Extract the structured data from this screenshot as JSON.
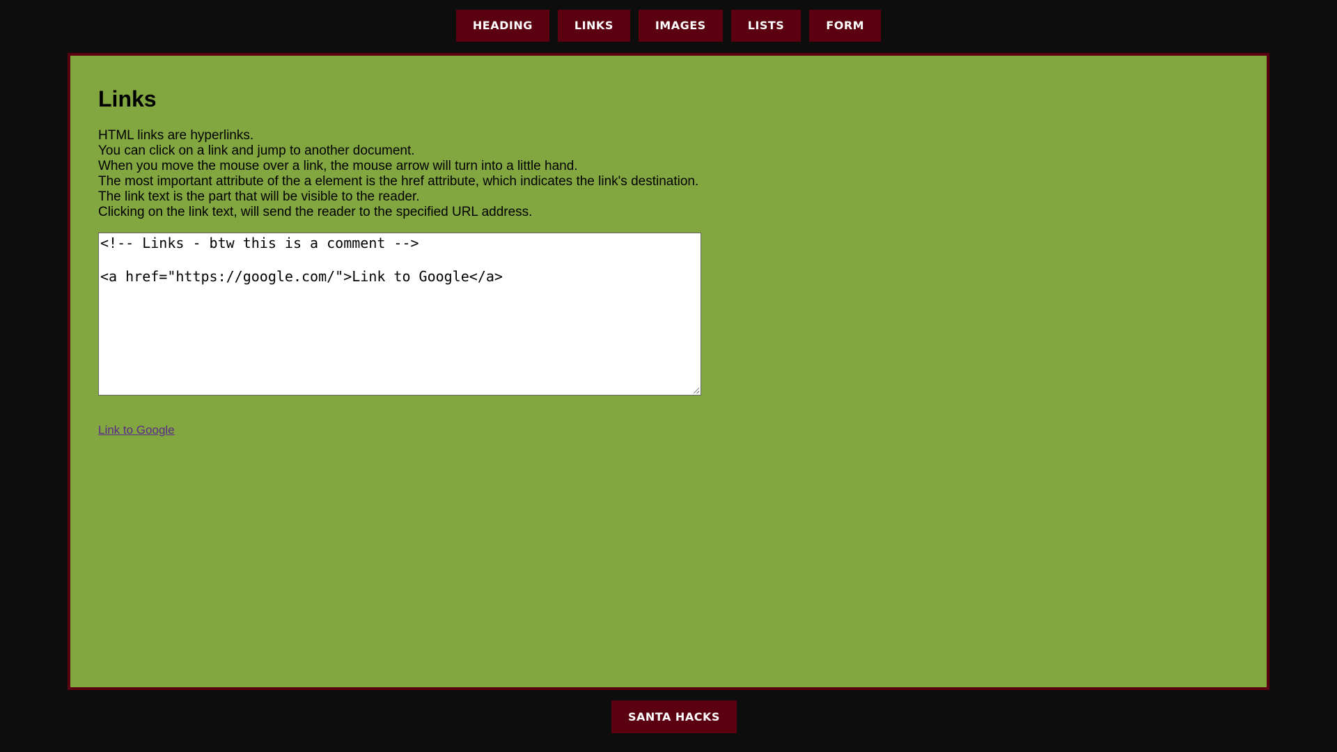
{
  "nav": {
    "items": [
      {
        "label": "Heading"
      },
      {
        "label": "Links"
      },
      {
        "label": "Images"
      },
      {
        "label": "Lists"
      },
      {
        "label": "Form"
      }
    ]
  },
  "colors": {
    "background": "#0d0d0d",
    "nav_button": "#5a0010",
    "panel": "#82a640",
    "panel_border": "#5a0010",
    "link": "#5a2a8a"
  },
  "main": {
    "title": "Links",
    "description": [
      "HTML links are hyperlinks.",
      "You can click on a link and jump to another document.",
      "When you move the mouse over a link, the mouse arrow will turn into a little hand.",
      "The most important attribute of the a element is the href attribute, which indicates the link's destination.",
      "The link text is the part that will be visible to the reader.",
      "Clicking on the link text, will send the reader to the specified URL address."
    ],
    "code_lines": [
      "<!-- Links - btw this is a comment -->",
      "",
      "<a href=\"https://google.com/\">Link to Google</a>"
    ],
    "output_link": "Link to Google"
  },
  "footer": {
    "button_label": "Santa Hacks"
  }
}
